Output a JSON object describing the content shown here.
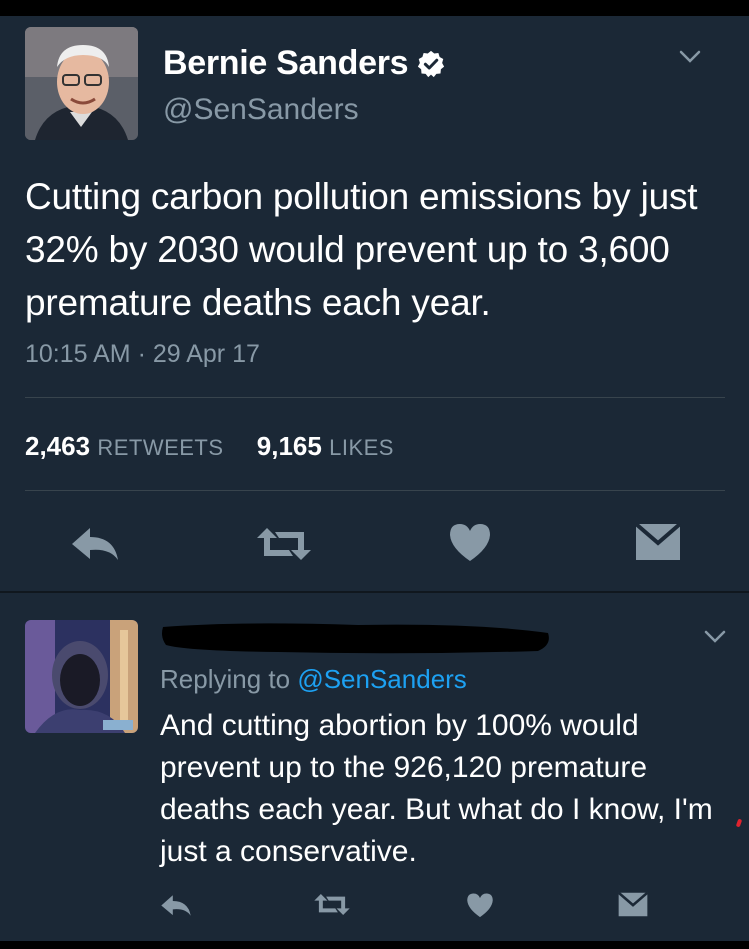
{
  "tweet": {
    "author_name": "Bernie Sanders",
    "author_handle": "@SenSanders",
    "verified": true,
    "text": "Cutting carbon pollution emissions by just 32% by 2030 would prevent up to 3,600 premature deaths each year.",
    "timestamp": "10:15 AM · 29 Apr 17",
    "retweets_count": "2,463",
    "retweets_label": "RETWEETS",
    "likes_count": "9,165",
    "likes_label": "LIKES",
    "actions": [
      "reply-icon",
      "retweet-icon",
      "heart-icon",
      "dm-icon"
    ]
  },
  "reply": {
    "author_name_redacted": true,
    "replying_prefix": "Replying to",
    "replying_to": "@SenSanders",
    "text": "And cutting abortion by 100% would prevent up to the 926,120 premature deaths each year. But what do I know, I'm just a conservative.",
    "actions": [
      "reply-icon",
      "retweet-icon",
      "heart-icon",
      "dm-icon"
    ]
  },
  "colors": {
    "background": "#1b2836",
    "secondary_text": "#8899a6",
    "link": "#1da1f2",
    "icon": "#8899a6",
    "verified_badge": "#ffffff"
  }
}
